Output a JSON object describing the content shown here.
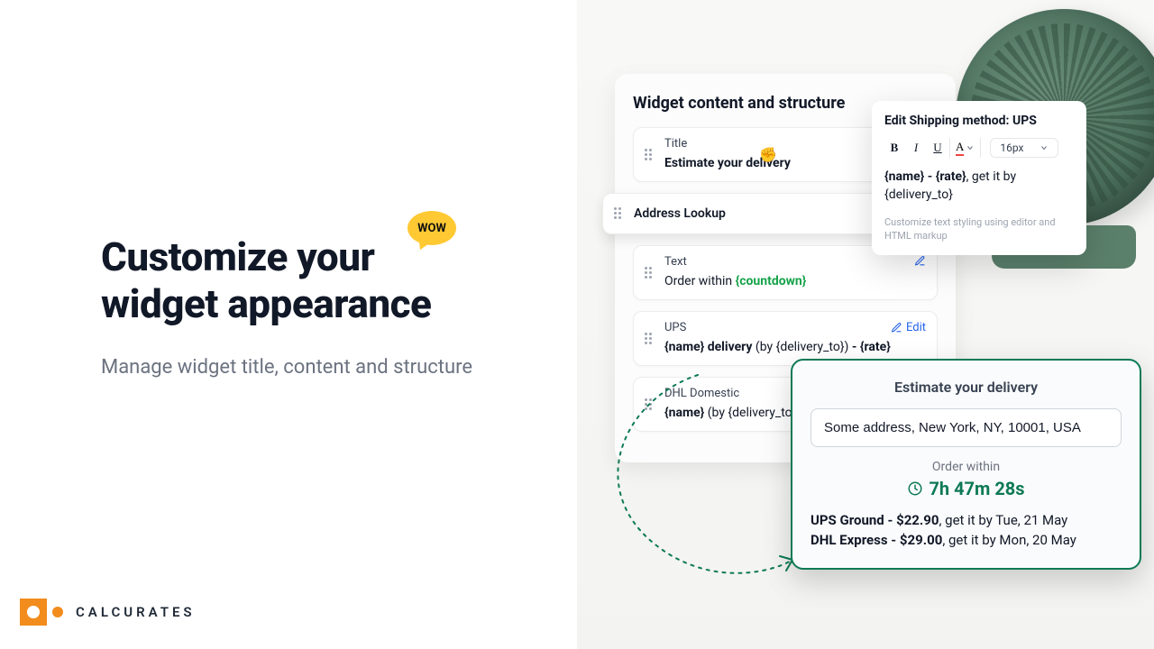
{
  "hero": {
    "title_line1": "Customize your",
    "title_line2": "widget appearance",
    "subtitle": "Manage widget title, content and structure",
    "wow": "WOW"
  },
  "brand": {
    "name": "CALCURATES"
  },
  "panel": {
    "title": "Widget content and structure",
    "edit_label": "Edit",
    "items": [
      {
        "label": "Title",
        "value": "Estimate your delivery"
      },
      {
        "label": "Address Lookup"
      },
      {
        "label": "Text",
        "value_prefix": "Order within ",
        "value_var": "{countdown}"
      },
      {
        "label": "UPS",
        "value_bold1": "{name} delivery",
        "value_plain": " (by {delivery_to}) ",
        "value_bold2": "- {rate}"
      },
      {
        "label": "DHL Domestic",
        "value_bold1": "{name}",
        "value_plain": " (by {delivery_to})",
        "value_bold2": ""
      }
    ]
  },
  "popover": {
    "title": "Edit Shipping method: UPS",
    "font_size": "16px",
    "line_bold": "{name} - {rate}",
    "line_plain": ", get it by {delivery_to}",
    "help": "Customize text styling using editor and HTML markup"
  },
  "preview": {
    "title": "Estimate your delivery",
    "address": "Some address, New York, NY, 10001, USA",
    "order_within": "Order within",
    "countdown": "7h 47m 28s",
    "lines": [
      {
        "bold": "UPS Ground - $22.90",
        "plain": ", get it by Tue, 21 May"
      },
      {
        "bold": "DHL Express - $29.00",
        "plain": ", get it by Mon, 20 May"
      }
    ]
  }
}
